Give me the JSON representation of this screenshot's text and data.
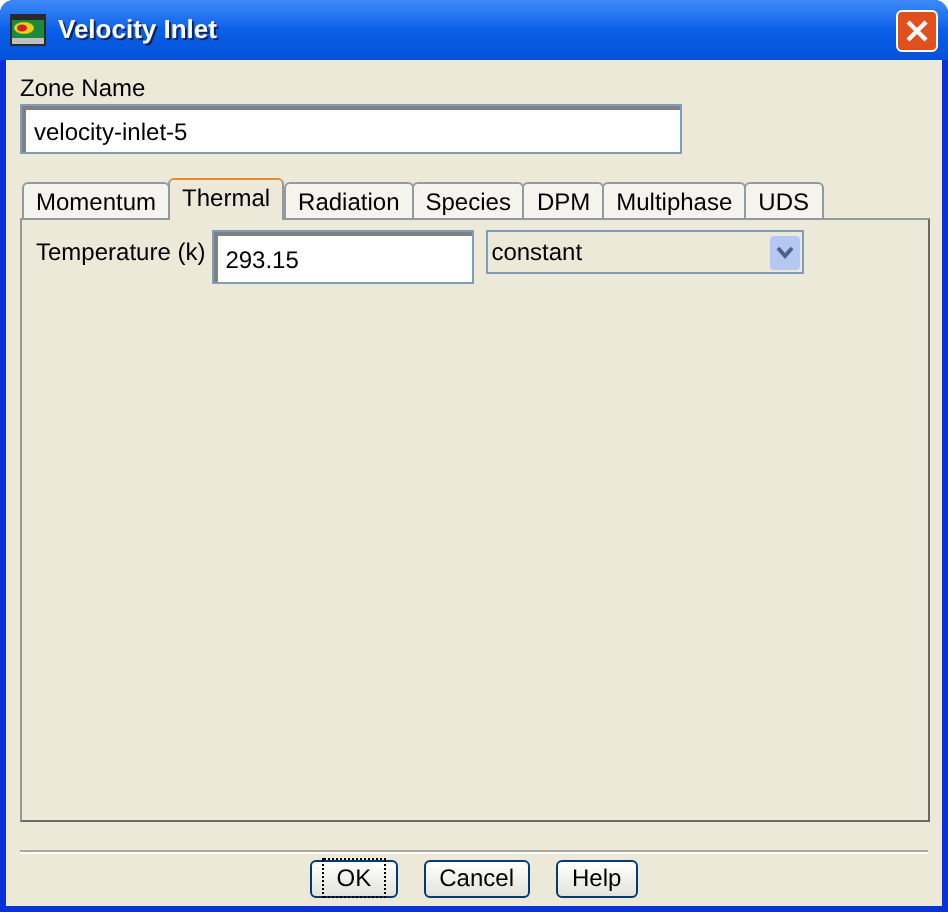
{
  "window": {
    "title": "Velocity Inlet"
  },
  "zone_name": {
    "label": "Zone Name",
    "value": "velocity-inlet-5"
  },
  "tabs": [
    {
      "label": "Momentum",
      "selected": false
    },
    {
      "label": "Thermal",
      "selected": true
    },
    {
      "label": "Radiation",
      "selected": false
    },
    {
      "label": "Species",
      "selected": false
    },
    {
      "label": "DPM",
      "selected": false
    },
    {
      "label": "Multiphase",
      "selected": false
    },
    {
      "label": "UDS",
      "selected": false
    }
  ],
  "temperature": {
    "label": "Temperature (k)",
    "value": "293.15",
    "method": "constant"
  },
  "buttons": [
    {
      "label": "OK",
      "focused": true
    },
    {
      "label": "Cancel",
      "focused": false
    },
    {
      "label": "Help",
      "focused": false
    }
  ]
}
